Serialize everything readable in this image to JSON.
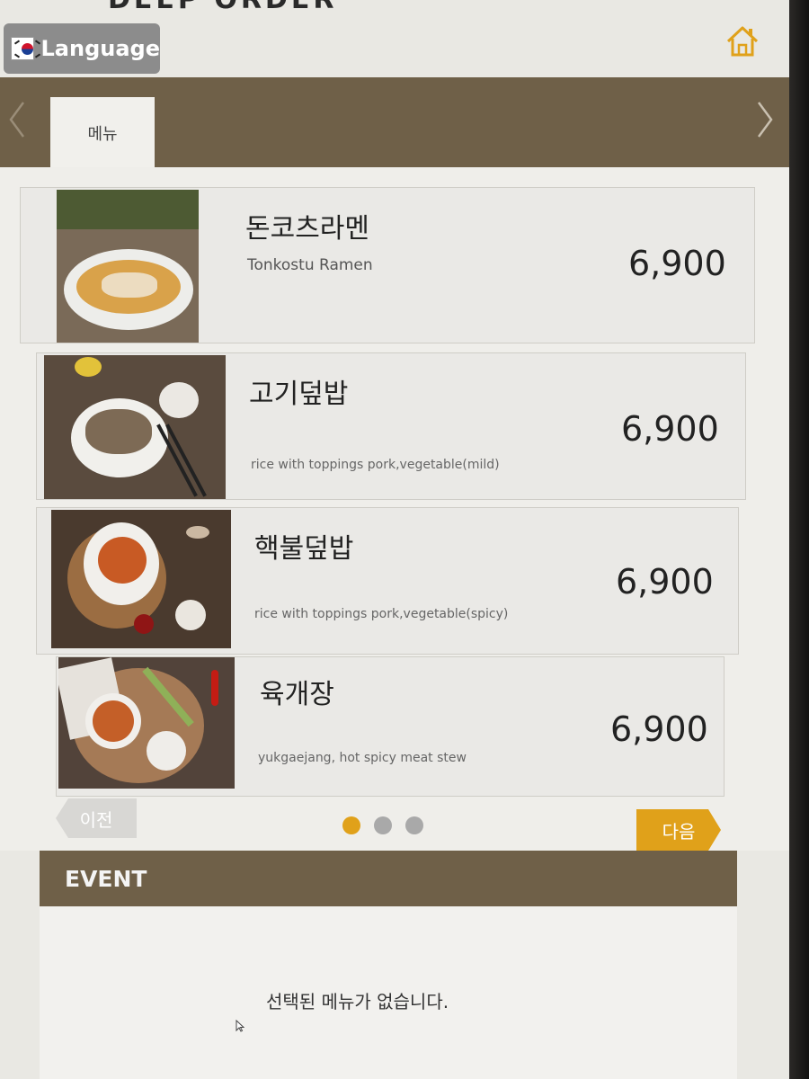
{
  "header": {
    "partial_title": "DEEP ORDER",
    "language_label": "Language",
    "home_icon": "home-icon",
    "flag_icon": "korea-flag-icon"
  },
  "tabs": [
    {
      "label": "메뉴",
      "active": true
    }
  ],
  "menu_items": [
    {
      "name": "돈코츠라멘",
      "description": "Tonkostu  Ramen",
      "price": "6,900",
      "photo": "ramen-photo"
    },
    {
      "name": "고기덮밥",
      "description": "rice with toppings pork,vegetable(mild)",
      "price": "6,900",
      "photo": "pork-rice-bowl-photo"
    },
    {
      "name": "핵불덮밥",
      "description": "rice with toppings pork,vegetable(spicy)",
      "price": "6,900",
      "photo": "spicy-pork-rice-photo"
    },
    {
      "name": "육개장",
      "description": "yukgaejang, hot spicy meat stew",
      "price": "6,900",
      "photo": "stew-photo"
    }
  ],
  "pagination": {
    "prev_label": "이전",
    "next_label": "다음",
    "pages": 3,
    "current_page": 1
  },
  "event": {
    "title": "EVENT",
    "empty_message": "선택된 메뉴가 없습니다."
  },
  "colors": {
    "brand_band": "#6f6048",
    "accent": "#e0a11a",
    "dot_active": "#e0a11a",
    "dot_inactive": "#a9a9a9"
  }
}
